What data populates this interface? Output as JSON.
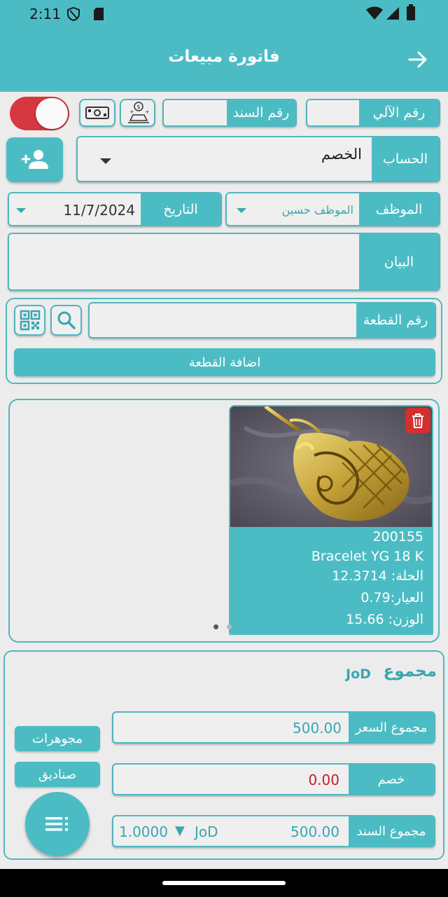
{
  "status": {
    "time": "2:11"
  },
  "header": {
    "title": "فاتورة مبيعات"
  },
  "top_row": {
    "auto_number_label": "رقم الآلي",
    "auto_number_value": "",
    "voucher_number_label": "رقم السند",
    "voucher_number_value": "",
    "toggle_on": true
  },
  "account": {
    "label": "الحساب",
    "value": "الخصم"
  },
  "employee": {
    "label": "الموظف",
    "value": "الموظف حسين"
  },
  "date": {
    "label": "التاريخ",
    "value": "11/7/2024"
  },
  "statement": {
    "label": "البيان",
    "value": ""
  },
  "item_search": {
    "label": "رقم القطعة",
    "value": "",
    "add_button": "اضافة القطعة"
  },
  "item_card": {
    "code": "200155",
    "name": "Bracelet YG 18 K",
    "jewelry": "الحلة: 12.3714",
    "caliber": "العيار:0.79",
    "weight": "الوزن: 15.66"
  },
  "totals": {
    "title": "مجموع",
    "currency": "JoD",
    "price_total_label": "مجموع السعر",
    "price_total_value": "500.00",
    "discount_label": "خصم",
    "discount_value": "0.00",
    "voucher_total_label": "مجموع السند",
    "voucher_total_value": "500.00",
    "voucher_currency": "JoD",
    "exchange_rate": "1.0000"
  },
  "side_buttons": {
    "jewelry": "مجوهرات",
    "boxes": "صناديق"
  },
  "colors": {
    "primary": "#4cbcc4",
    "toggle": "#d7373f",
    "delete": "#d32f2f",
    "discount": "#c0202a"
  }
}
